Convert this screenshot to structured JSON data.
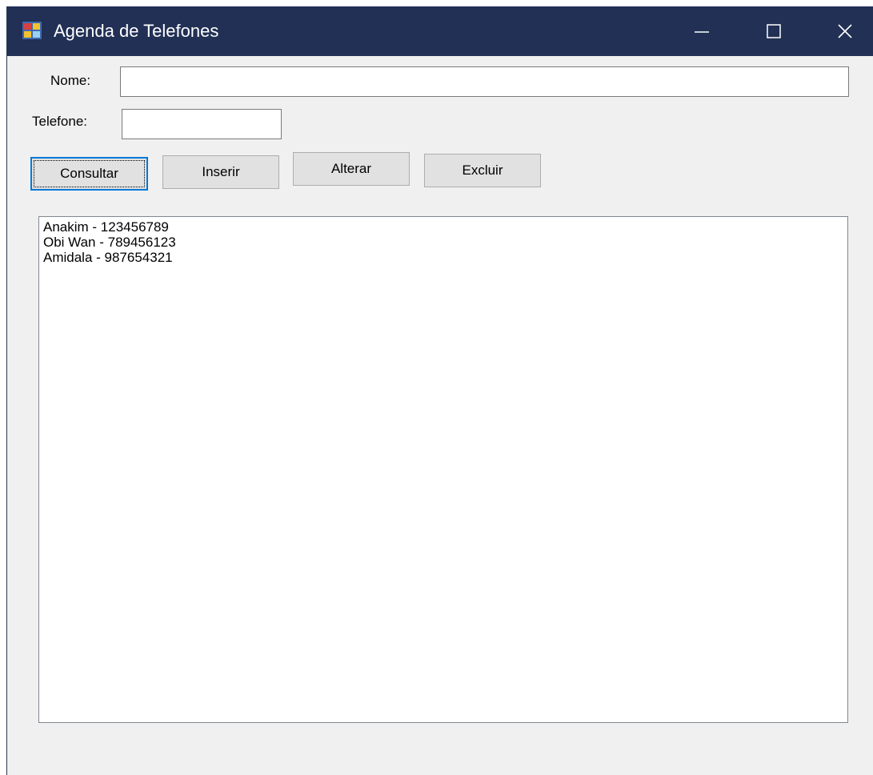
{
  "window": {
    "title": "Agenda de Telefones",
    "icon": "app-form-icon",
    "controls": [
      "minimize-icon",
      "maximize-icon",
      "close-icon"
    ],
    "titlebar_color": "#223055"
  },
  "form": {
    "nome_label": "Nome:",
    "nome_value": "",
    "telefone_label": "Telefone:",
    "telefone_value": ""
  },
  "buttons": {
    "consultar": "Consultar",
    "inserir": "Inserir",
    "alterar": "Alterar",
    "excluir": "Excluir"
  },
  "list": {
    "items": [
      "Anakim - 123456789",
      "Obi Wan - 789456123",
      "Amidala - 987654321"
    ]
  }
}
